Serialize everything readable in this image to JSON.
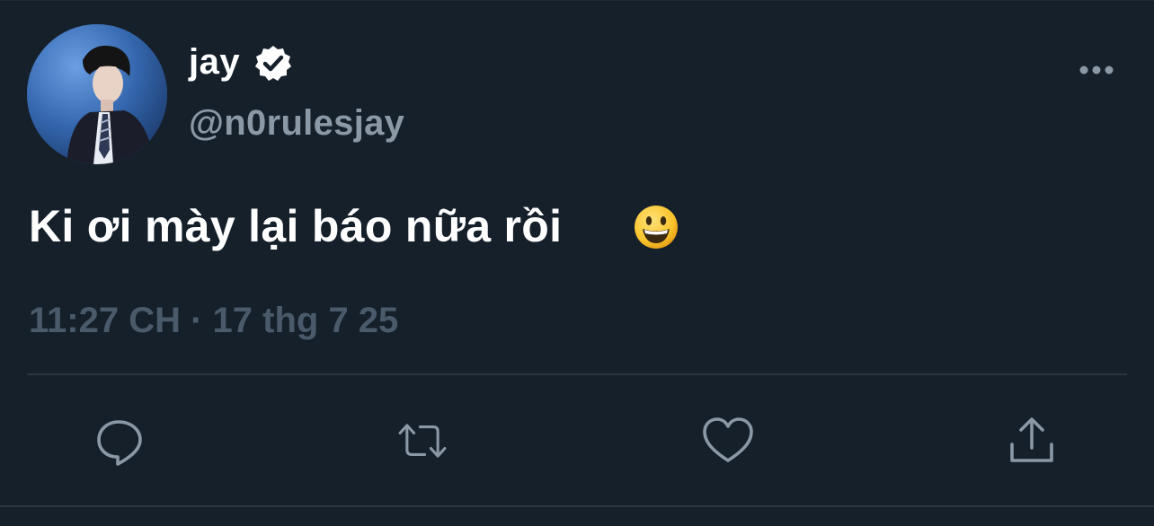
{
  "tweet": {
    "display_name": "jay",
    "handle": "@n0rulesjay",
    "text": "Ki ơi mày lại báo nữa rồi",
    "emoji": "smiling-face-with-open-mouth-emoji",
    "timestamp": "11:27 CH · 17 thg 7 25",
    "verified": true
  },
  "actions": [
    {
      "name": "reply",
      "icon": "speech-bubble-icon"
    },
    {
      "name": "retweet",
      "icon": "retweet-arrows-icon"
    },
    {
      "name": "like",
      "icon": "heart-icon"
    },
    {
      "name": "share",
      "icon": "share-upload-icon"
    }
  ],
  "colors": {
    "background": "#15202b",
    "primary_text": "#ffffff",
    "secondary_text": "#8b98a5",
    "timestamp_text": "#4a5a6a",
    "icon": "#8b98a5",
    "divider": "#2a3541"
  }
}
